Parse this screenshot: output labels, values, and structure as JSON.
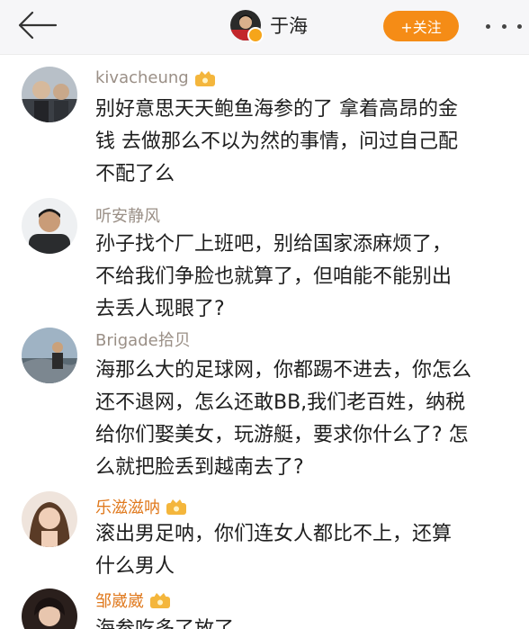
{
  "header": {
    "user_name": "于海",
    "follow_label": "+关注",
    "colors": {
      "background": "#f6f6f8",
      "follow": "#f58c16",
      "badge": "#f6a51a"
    }
  },
  "comments": [
    {
      "name": "kivacheung",
      "name_style": "gray",
      "vip": true,
      "text": "别好意思天天鲍鱼海参的了 拿着高昂的金\n钱 去做那么不以为然的事情，问过自己配\n不配了么"
    },
    {
      "name": "听安静风",
      "name_style": "gray",
      "vip": false,
      "text": "孙子找个厂上班吧，别给国家添麻烦了，\n不给我们争脸也就算了，但咱能不能别出\n去丢人现眼了?"
    },
    {
      "name": "Brigade拾贝",
      "name_style": "gray",
      "vip": false,
      "text": "海那么大的足球网，你都踢不进去，你怎么\n还不退网，怎么还敢BB,我们老百姓，纳税\n给你们娶美女，玩游艇，要求你什么了? 怎\n么就把脸丢到越南去了?"
    },
    {
      "name": "乐滋滋呐",
      "name_style": "orange",
      "vip": true,
      "text": "滚出男足呐，你们连女人都比不上，还算\n什么男人"
    },
    {
      "name": "邹崴崴",
      "name_style": "orange",
      "vip": true,
      "text": "海参吃多了放了"
    }
  ]
}
